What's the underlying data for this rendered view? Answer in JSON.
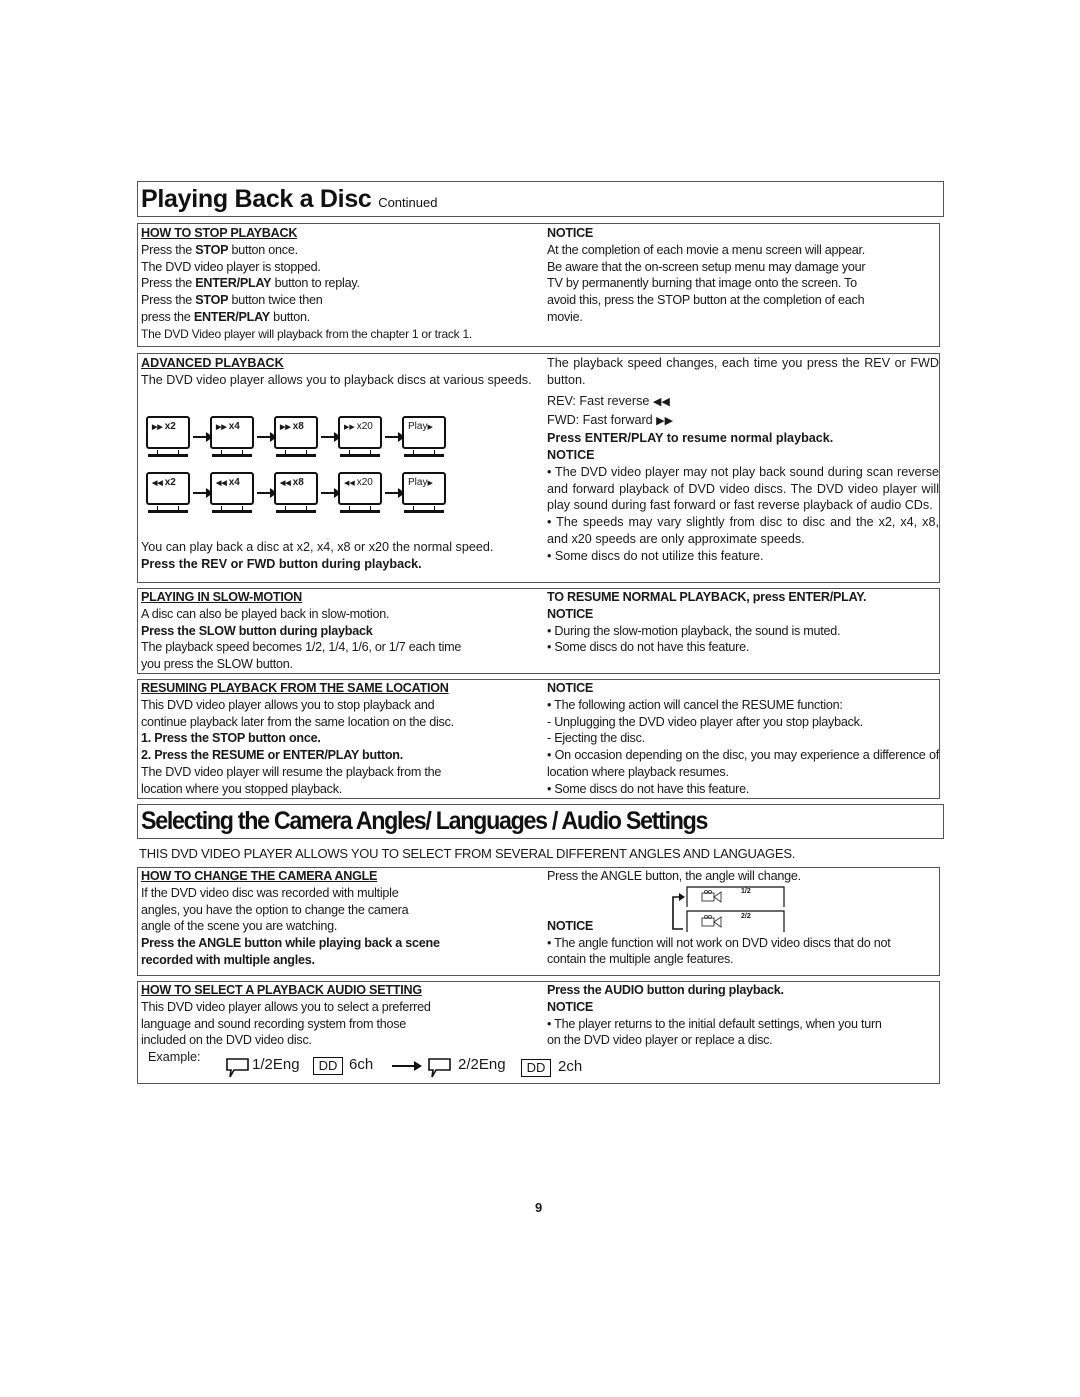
{
  "page": {
    "title": "Playing Back a Disc",
    "title_suffix": "Continued",
    "title2": "Selecting the Camera Angles/ Languages / Audio Settings",
    "intro2": "THIS DVD VIDEO PLAYER ALLOWS YOU TO SELECT FROM SEVERAL DIFFERENT ANGLES AND LANGUAGES.",
    "page_number": "9"
  },
  "stop": {
    "heading": "HOW TO STOP PLAYBACK",
    "lines": [
      {
        "pre": "Press the ",
        "b": "STOP",
        "post": " button once."
      },
      {
        "pre": "The DVD video player is stopped.",
        "b": "",
        "post": ""
      },
      {
        "pre": "Press the ",
        "b": "ENTER/PLAY",
        "post": " button to replay."
      },
      {
        "pre": "Press the ",
        "b": "STOP",
        "post": " button twice then"
      },
      {
        "pre": "press the ",
        "b": "ENTER/PLAY",
        "post": " button."
      },
      {
        "pre": "The DVD Video player will playback from the chapter 1 or track 1.",
        "b": "",
        "post": ""
      }
    ],
    "notice_heading": "NOTICE",
    "notice_lines": [
      "At the completion of each movie a menu screen will appear.",
      "Be aware that the on-screen setup menu may damage your",
      "TV by permanently burning that image onto the screen.  To",
      "avoid this, press the STOP button at the completion of each",
      "movie."
    ]
  },
  "advanced": {
    "heading": "ADVANCED PLAYBACK",
    "intro": "The DVD video player allows you to playback discs at various speeds.",
    "fwd_screens": [
      {
        "icon": "fast-forward-icon",
        "glyph": "⏩",
        "label": "x2"
      },
      {
        "icon": "fast-forward-icon",
        "glyph": "⏩",
        "label": "x4"
      },
      {
        "icon": "fast-forward-icon",
        "glyph": "⏩",
        "label": "x8"
      },
      {
        "icon": "fast-forward-icon",
        "glyph": "⏩",
        "label": "x20"
      },
      {
        "icon": "play-icon",
        "glyph": "▶",
        "label": "Play"
      }
    ],
    "rev_screens": [
      {
        "icon": "fast-reverse-icon",
        "glyph": "⏪",
        "label": "x2"
      },
      {
        "icon": "fast-reverse-icon",
        "glyph": "⏪",
        "label": "x4"
      },
      {
        "icon": "fast-reverse-icon",
        "glyph": "⏪",
        "label": "x8"
      },
      {
        "icon": "fast-reverse-icon",
        "glyph": "⏪",
        "label": "x20"
      },
      {
        "icon": "play-icon",
        "glyph": "▶",
        "label": "Play"
      }
    ],
    "speeds_text": "You can play back a disc at x2, x4, x8 or x20 the normal speed.",
    "instruction": "Press the REV or FWD button during playback.",
    "right_intro": "The playback speed changes, each time you press the REV or FWD button.",
    "rev_line": "REV:  Fast reverse",
    "fwd_line": "FWD:  Fast forward",
    "resume": "Press ENTER/PLAY to resume normal playback.",
    "notice_heading": "NOTICE",
    "notice_1": "• The DVD video player may not play back sound  during scan reverse and forward playback of DVD video discs. The DVD video player will play sound during fast forward or fast reverse playback of audio CDs.",
    "notice_2": "• The speeds may vary slightly from disc to disc and the x2, x4, x8, and x20 speeds are only approximate speeds.",
    "notice_3": "• Some discs do not utilize this feature."
  },
  "slow": {
    "heading": "PLAYING IN SLOW-MOTION",
    "line1": "A disc can also be played back in slow-motion.",
    "instruction": "Press the SLOW button during playback",
    "line2": "The playback speed becomes 1/2, 1/4, 1/6, or 1/7 each time",
    "line3": "you press the SLOW button.",
    "resume": "TO RESUME NORMAL PLAYBACK, press ENTER/PLAY.",
    "notice_heading": "NOTICE",
    "notice_1": "• During the slow-motion playback, the sound is muted.",
    "notice_2": "• Some discs do not have this feature."
  },
  "resume": {
    "heading": "RESUMING PLAYBACK FROM THE SAME LOCATION",
    "line1": "This DVD video player allows you to stop playback and",
    "line2": "continue playback later from the same location on the disc.",
    "step1": "1. Press the STOP button once.",
    "step2": "2. Press the RESUME or ENTER/PLAY button.",
    "line3": "The DVD video player will resume the playback from the",
    "line4": "location where you stopped playback.",
    "notice_heading": "NOTICE",
    "notice_1": "• The following action will cancel the RESUME function:",
    "notice_2": "- Unplugging the DVD video player after you stop playback.",
    "notice_3": "- Ejecting the disc.",
    "notice_4": "• On occasion depending on the disc, you may experience a difference of location where playback resumes.",
    "notice_5": "• Some discs do not have this feature."
  },
  "angle": {
    "heading": "HOW TO CHANGE THE CAMERA ANGLE",
    "line1": "If the DVD video disc was recorded with multiple",
    "line2": "angles, you have the option to change the camera",
    "line3": "angle of the scene you are watching.",
    "instruction1": "Press the ANGLE button while playing back a scene",
    "instruction2": "recorded with multiple angles.",
    "right_intro": "Press the ANGLE button, the angle will change.",
    "screens": [
      "1/2",
      "2/2"
    ],
    "notice_heading": "NOTICE",
    "notice_1": "• The angle function will not work on DVD video discs that do not",
    "notice_2": "contain the multiple angle features."
  },
  "audio": {
    "heading": "HOW TO SELECT A PLAYBACK AUDIO SETTING",
    "line1": "This DVD video player allows you to select a preferred",
    "line2": "language and sound recording system from those",
    "line3": "included on the DVD video disc.",
    "instruction": "Press the AUDIO button during playback.",
    "notice_heading": "NOTICE",
    "notice_1": "• The player returns to the initial default settings, when you turn",
    "notice_2": "on the DVD video player or replace a disc.",
    "example_label": "Example:",
    "example_from_lang": "1/2Eng",
    "example_from_ch": "6ch",
    "example_to_lang": "2/2Eng",
    "example_to_ch": "2ch",
    "dolby_label": "DD"
  }
}
